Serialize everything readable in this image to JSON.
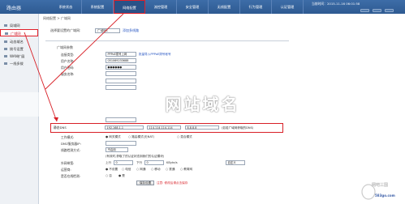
{
  "header": {
    "brand": "路由器",
    "nav": [
      "系统状态",
      "系统配置",
      "网络配置",
      "流控管理",
      "安全管理",
      "无线配置",
      "行为管理",
      "认证管理",
      "VPN应用",
      "系统监控",
      "系统工具",
      "系统安全"
    ],
    "active_index": 2,
    "info": "当前时间：2015-11-16 06:01:58"
  },
  "sidebar": {
    "items": [
      "局域网",
      "广域网",
      "动态域名",
      "拨号设置",
      "WAN扩展",
      "一线多拨"
    ],
    "selected_index": 1
  },
  "breadcrumb": "网络配置 > 广域网",
  "iface": {
    "label": "选择要设置的广域网:",
    "value": "广域网1",
    "add_link": "添加多线路"
  },
  "section_title": "广域网参数",
  "fields": [
    {
      "label": "连接类型:",
      "value": "PPPoE拨号上网",
      "link": "批量导入PPPoE拨号帐号"
    },
    {
      "label": "用户名称:",
      "value": "051069233688"
    },
    {
      "label": "用户密码:",
      "value": "●●●●●●"
    },
    {
      "label": "服务名称:",
      "value": ""
    },
    {
      "label": "",
      "value": ""
    },
    {
      "label": "",
      "value": ""
    },
    {
      "label": "",
      "value": ""
    },
    {
      "label": "",
      "value": ""
    }
  ],
  "dns": {
    "label": "静态DNS",
    "values": [
      "192.168.1.1",
      "114.114.114.114",
      "8.8.8.8"
    ],
    "hint": "(如若广域网获取的DNS)"
  },
  "work_mode": {
    "label": "工作模式:",
    "options": [
      "网关模式",
      "路由模式(无NAT)",
      "混合模式"
    ]
  },
  "dmz": {
    "label": "DMZ服务器IP:",
    "value": ""
  },
  "detect": {
    "label": "线路检测方式:",
    "value": "不启用"
  },
  "misc_line": "(有效时,获取了的认证状态到我们的认证模块)",
  "bandwidth": {
    "label": "外网带宽:",
    "up": "上行",
    "up_val": "0",
    "down": "下行",
    "down_val": "0",
    "unit": "KByte/s",
    "select": "自定义"
  },
  "pattern": {
    "label": "运营商:",
    "options": [
      "不设置",
      "电信",
      "网通",
      "移动",
      "铁通",
      "教育网"
    ]
  },
  "schedule": {
    "label": "是否在线检测:",
    "options": [
      "否",
      "是"
    ]
  },
  "save_button": "保存设置",
  "note_red": "注意: 修改后请点击保存",
  "title_banner": "网站域名",
  "watermark": {
    "line1": "网吧三国",
    "line2": "583go.com"
  },
  "colors": {
    "header": "#2e5a91",
    "highlight": "#d81f26",
    "link": "#2050c0"
  }
}
